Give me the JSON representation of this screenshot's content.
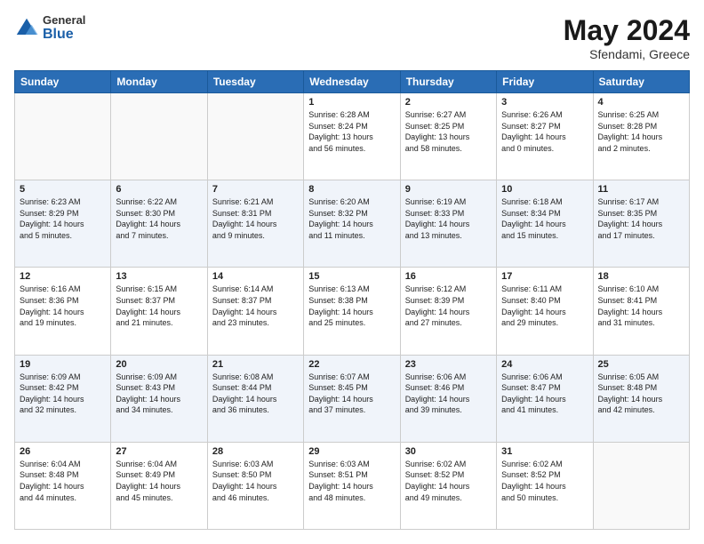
{
  "header": {
    "logo_general": "General",
    "logo_blue": "Blue",
    "month": "May 2024",
    "location": "Sfendami, Greece"
  },
  "days_of_week": [
    "Sunday",
    "Monday",
    "Tuesday",
    "Wednesday",
    "Thursday",
    "Friday",
    "Saturday"
  ],
  "weeks": [
    [
      {
        "day": "",
        "info": ""
      },
      {
        "day": "",
        "info": ""
      },
      {
        "day": "",
        "info": ""
      },
      {
        "day": "1",
        "info": "Sunrise: 6:28 AM\nSunset: 8:24 PM\nDaylight: 13 hours\nand 56 minutes."
      },
      {
        "day": "2",
        "info": "Sunrise: 6:27 AM\nSunset: 8:25 PM\nDaylight: 13 hours\nand 58 minutes."
      },
      {
        "day": "3",
        "info": "Sunrise: 6:26 AM\nSunset: 8:27 PM\nDaylight: 14 hours\nand 0 minutes."
      },
      {
        "day": "4",
        "info": "Sunrise: 6:25 AM\nSunset: 8:28 PM\nDaylight: 14 hours\nand 2 minutes."
      }
    ],
    [
      {
        "day": "5",
        "info": "Sunrise: 6:23 AM\nSunset: 8:29 PM\nDaylight: 14 hours\nand 5 minutes."
      },
      {
        "day": "6",
        "info": "Sunrise: 6:22 AM\nSunset: 8:30 PM\nDaylight: 14 hours\nand 7 minutes."
      },
      {
        "day": "7",
        "info": "Sunrise: 6:21 AM\nSunset: 8:31 PM\nDaylight: 14 hours\nand 9 minutes."
      },
      {
        "day": "8",
        "info": "Sunrise: 6:20 AM\nSunset: 8:32 PM\nDaylight: 14 hours\nand 11 minutes."
      },
      {
        "day": "9",
        "info": "Sunrise: 6:19 AM\nSunset: 8:33 PM\nDaylight: 14 hours\nand 13 minutes."
      },
      {
        "day": "10",
        "info": "Sunrise: 6:18 AM\nSunset: 8:34 PM\nDaylight: 14 hours\nand 15 minutes."
      },
      {
        "day": "11",
        "info": "Sunrise: 6:17 AM\nSunset: 8:35 PM\nDaylight: 14 hours\nand 17 minutes."
      }
    ],
    [
      {
        "day": "12",
        "info": "Sunrise: 6:16 AM\nSunset: 8:36 PM\nDaylight: 14 hours\nand 19 minutes."
      },
      {
        "day": "13",
        "info": "Sunrise: 6:15 AM\nSunset: 8:37 PM\nDaylight: 14 hours\nand 21 minutes."
      },
      {
        "day": "14",
        "info": "Sunrise: 6:14 AM\nSunset: 8:37 PM\nDaylight: 14 hours\nand 23 minutes."
      },
      {
        "day": "15",
        "info": "Sunrise: 6:13 AM\nSunset: 8:38 PM\nDaylight: 14 hours\nand 25 minutes."
      },
      {
        "day": "16",
        "info": "Sunrise: 6:12 AM\nSunset: 8:39 PM\nDaylight: 14 hours\nand 27 minutes."
      },
      {
        "day": "17",
        "info": "Sunrise: 6:11 AM\nSunset: 8:40 PM\nDaylight: 14 hours\nand 29 minutes."
      },
      {
        "day": "18",
        "info": "Sunrise: 6:10 AM\nSunset: 8:41 PM\nDaylight: 14 hours\nand 31 minutes."
      }
    ],
    [
      {
        "day": "19",
        "info": "Sunrise: 6:09 AM\nSunset: 8:42 PM\nDaylight: 14 hours\nand 32 minutes."
      },
      {
        "day": "20",
        "info": "Sunrise: 6:09 AM\nSunset: 8:43 PM\nDaylight: 14 hours\nand 34 minutes."
      },
      {
        "day": "21",
        "info": "Sunrise: 6:08 AM\nSunset: 8:44 PM\nDaylight: 14 hours\nand 36 minutes."
      },
      {
        "day": "22",
        "info": "Sunrise: 6:07 AM\nSunset: 8:45 PM\nDaylight: 14 hours\nand 37 minutes."
      },
      {
        "day": "23",
        "info": "Sunrise: 6:06 AM\nSunset: 8:46 PM\nDaylight: 14 hours\nand 39 minutes."
      },
      {
        "day": "24",
        "info": "Sunrise: 6:06 AM\nSunset: 8:47 PM\nDaylight: 14 hours\nand 41 minutes."
      },
      {
        "day": "25",
        "info": "Sunrise: 6:05 AM\nSunset: 8:48 PM\nDaylight: 14 hours\nand 42 minutes."
      }
    ],
    [
      {
        "day": "26",
        "info": "Sunrise: 6:04 AM\nSunset: 8:48 PM\nDaylight: 14 hours\nand 44 minutes."
      },
      {
        "day": "27",
        "info": "Sunrise: 6:04 AM\nSunset: 8:49 PM\nDaylight: 14 hours\nand 45 minutes."
      },
      {
        "day": "28",
        "info": "Sunrise: 6:03 AM\nSunset: 8:50 PM\nDaylight: 14 hours\nand 46 minutes."
      },
      {
        "day": "29",
        "info": "Sunrise: 6:03 AM\nSunset: 8:51 PM\nDaylight: 14 hours\nand 48 minutes."
      },
      {
        "day": "30",
        "info": "Sunrise: 6:02 AM\nSunset: 8:52 PM\nDaylight: 14 hours\nand 49 minutes."
      },
      {
        "day": "31",
        "info": "Sunrise: 6:02 AM\nSunset: 8:52 PM\nDaylight: 14 hours\nand 50 minutes."
      },
      {
        "day": "",
        "info": ""
      }
    ]
  ]
}
